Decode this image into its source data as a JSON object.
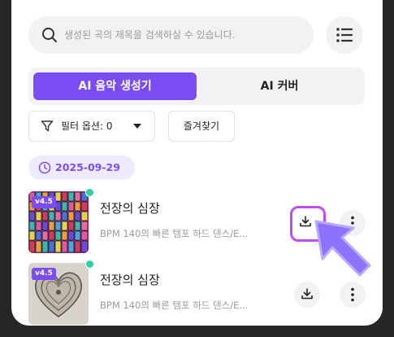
{
  "search": {
    "placeholder": "생성된 곡의 제목을 검색하실 수 있습니다.",
    "value": ""
  },
  "tabs": [
    {
      "label": "AI 음악 생성기",
      "active": true
    },
    {
      "label": "AI 커버",
      "active": false
    }
  ],
  "filter": {
    "label": "필터 옵션: 0"
  },
  "favorites": {
    "label": "즐겨찾기"
  },
  "date_group": {
    "date": "2025-09-29"
  },
  "songs": [
    {
      "title": "전장의 심장",
      "description": "BPM 140의 빠른 템포 하드 댄스/E...",
      "version": "v4.5",
      "status": "new"
    },
    {
      "title": "전장의 심장",
      "description": "BPM 140의 빠른 템포 하드 댄스/E...",
      "version": "v4.5",
      "status": "new"
    }
  ],
  "colors": {
    "accent": "#7a4df4",
    "highlight": "#c24bf5",
    "status_dot": "#2fd1a0",
    "pointer": "#8e72ff"
  },
  "icons": {
    "search": "search-icon",
    "menu": "list-icon",
    "filter": "filter-icon",
    "clock": "clock-icon",
    "download": "download-icon",
    "more": "more-vertical-icon",
    "pointer": "cursor-arrow-icon"
  }
}
